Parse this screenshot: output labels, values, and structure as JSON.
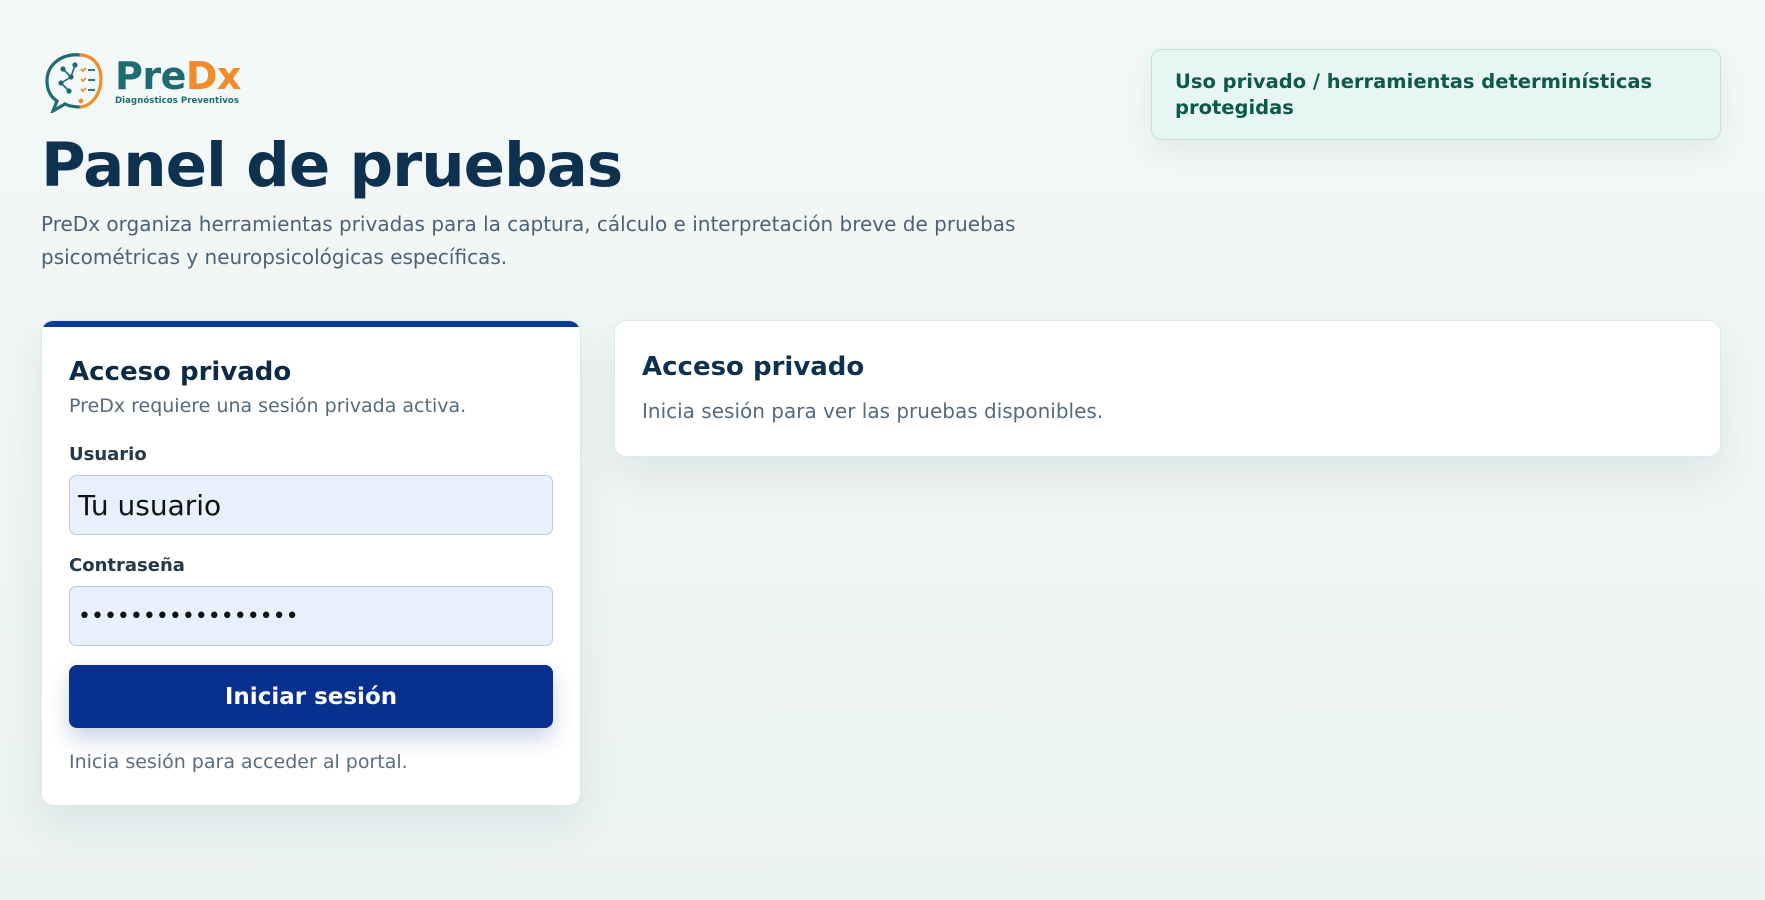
{
  "brand": {
    "name_part1": "Pre",
    "name_part2": "Dx",
    "tagline": "Diagnósticos Preventivos",
    "colors": {
      "teal": "#1d6b73",
      "orange": "#f08c2a"
    }
  },
  "header": {
    "title": "Panel de pruebas",
    "description": "PreDx organiza herramientas privadas para la captura, cálculo e interpretación breve de pruebas psicométricas y neuropsicológicas específicas.",
    "badge": "Uso privado / herramientas determinísticas protegidas"
  },
  "login": {
    "title": "Acceso privado",
    "subtitle": "PreDx requiere una sesión privada activa.",
    "user_label": "Usuario",
    "user_placeholder": "Tu usuario",
    "password_label": "Contraseña",
    "password_value": "•••••••••••••••••",
    "submit_label": "Iniciar sesión",
    "hint": "Inicia sesión para acceder al portal."
  },
  "info": {
    "title": "Acceso privado",
    "text": "Inicia sesión para ver las pruebas disponibles."
  },
  "colors": {
    "primary": "#08308f",
    "badge_bg": "#e7f6f3",
    "badge_text": "#0c5a47",
    "heading": "#0e3150"
  }
}
